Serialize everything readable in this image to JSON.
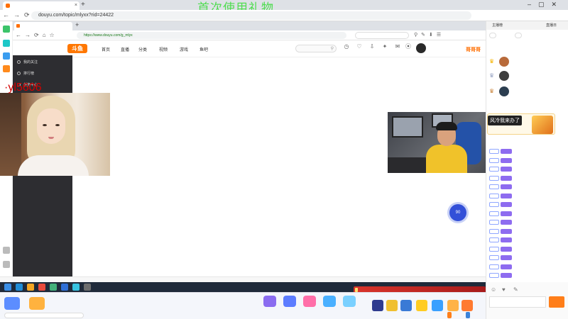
{
  "outer_browser": {
    "tab_title": "",
    "url": "douyu.com/topic/mlyxx?rid=24422",
    "overlay_title": "首次使用礼物"
  },
  "inner_browser": {
    "tab_title": "",
    "url": "https://www.douyu.com/g_mlyx",
    "search_text": ""
  },
  "site_header": {
    "logo_text": "斗鱼",
    "nav": [
      "首页",
      "直播",
      "分类",
      "视频",
      "游戏",
      "鱼吧"
    ],
    "brand_right": "哥哥哥",
    "icons": [
      {
        "icon": "history-icon",
        "label": ""
      },
      {
        "icon": "follow-icon",
        "label": ""
      },
      {
        "icon": "download-icon",
        "label": ""
      },
      {
        "icon": "creator-icon",
        "label": ""
      },
      {
        "icon": "message-icon",
        "label": ""
      },
      {
        "icon": "broadcast-icon",
        "label": ""
      }
    ]
  },
  "dropdown": {
    "items": [
      {
        "icon": "record-icon",
        "label": "我的关注"
      },
      {
        "icon": "rank-icon",
        "label": "排行榜"
      },
      {
        "icon": "task-icon",
        "label": "任务中心"
      }
    ],
    "sections": [
      {
        "title": "",
        "more": "",
        "entries": [
          "",
          "",
          "",
          "",
          "",
          "",
          "",
          "",
          "",
          "",
          "",
          ""
        ]
      },
      {
        "title": "",
        "more": "",
        "entries": [
          "",
          "",
          "",
          "",
          "",
          "",
          "",
          "",
          "",
          "",
          "",
          ""
        ]
      }
    ]
  },
  "overlay_text": "   ·yl5606",
  "floating_button_label": "90",
  "chat": {
    "tabs": [
      "主播榜",
      "",
      "直播日"
    ],
    "sub_pills": [
      "",
      ""
    ],
    "notice": "",
    "ranking": [
      {
        "avatar_color": "#b86a3a",
        "name": ""
      },
      {
        "avatar_color": "#3d3d3d",
        "name": ""
      },
      {
        "avatar_color": "#2c3e50",
        "name": ""
      }
    ],
    "enter_label": "",
    "gift_popup": {
      "badge": "风冷我来办了",
      "sub": ""
    },
    "messages": [
      {
        "lv": "",
        "user": "",
        "text": ""
      },
      {
        "lv": "",
        "user": "",
        "text": ""
      },
      {
        "lv": "",
        "user": "",
        "text": ""
      },
      {
        "lv": "",
        "user": "",
        "text": ""
      },
      {
        "lv": "",
        "user": "",
        "text": ""
      },
      {
        "lv": "",
        "user": "",
        "text": ""
      },
      {
        "lv": "",
        "user": "",
        "text": ""
      },
      {
        "lv": "",
        "user": "",
        "text": ""
      },
      {
        "lv": "",
        "user": "",
        "text": ""
      },
      {
        "lv": "",
        "user": "",
        "text": ""
      },
      {
        "lv": "",
        "user": "",
        "text": ""
      },
      {
        "lv": "",
        "user": "",
        "text": ""
      },
      {
        "lv": "",
        "user": "",
        "text": ""
      },
      {
        "lv": "",
        "user": "",
        "text": ""
      },
      {
        "lv": "",
        "user": "",
        "text": ""
      },
      {
        "lv": "",
        "user": "",
        "text": ""
      }
    ],
    "input_placeholder": "",
    "send_label": ""
  },
  "statusbar": {
    "left": "",
    "right": ""
  },
  "taskbar": {
    "clock": ""
  },
  "stream_banner": {
    "tag": "",
    "text": ""
  },
  "giftbar": {
    "left_items": [
      "",
      ""
    ],
    "prompt": "",
    "gifts": [
      {
        "label": "",
        "color": "#8a6cf0"
      },
      {
        "label": "",
        "color": "#5c7cff"
      },
      {
        "label": "",
        "color": "#ff6ea8"
      },
      {
        "label": "",
        "color": "#4ab0ff"
      },
      {
        "label": "",
        "color": "#7ad0ff"
      }
    ],
    "stats": "",
    "btn_recharge": "",
    "btn_gift": ""
  },
  "colors": {
    "brand": "#ff7700",
    "chat_user": "#3b82d8"
  }
}
